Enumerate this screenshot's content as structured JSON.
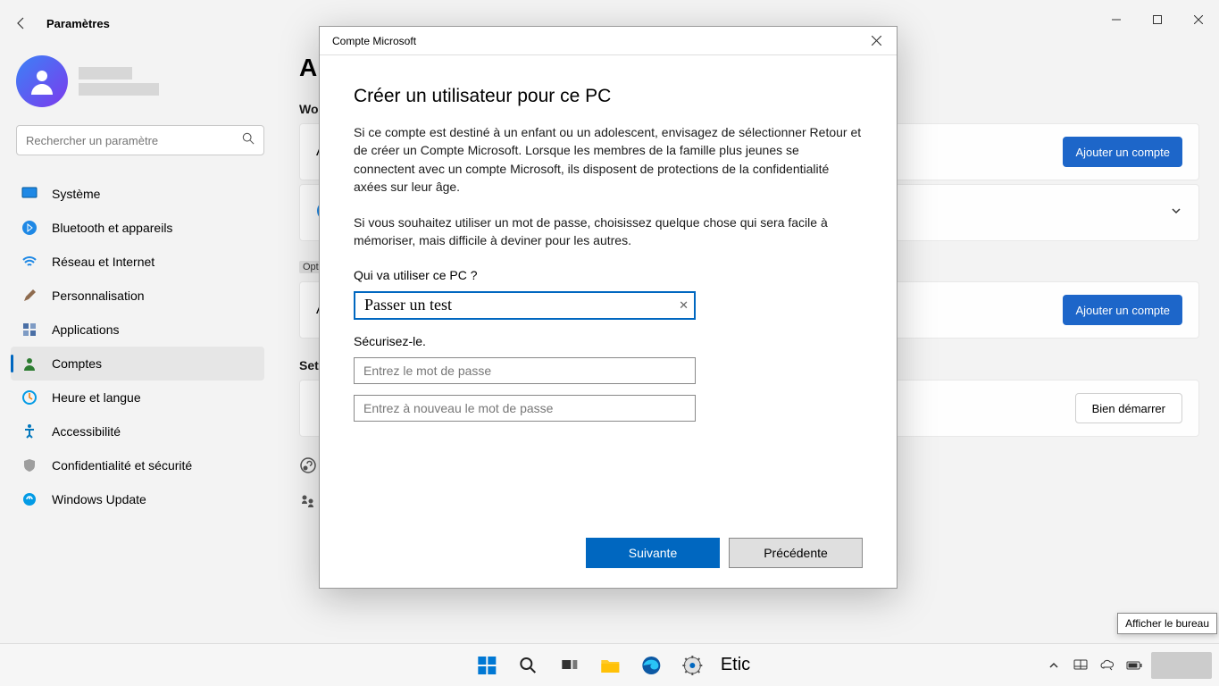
{
  "header": {
    "app_title": "Paramètres"
  },
  "search": {
    "placeholder": "Rechercher un paramètre"
  },
  "sidebar": {
    "items": [
      {
        "label": "Système"
      },
      {
        "label": "Bluetooth et appareils"
      },
      {
        "label": "Réseau et Internet"
      },
      {
        "label": "Personnalisation"
      },
      {
        "label": "Applications"
      },
      {
        "label": "Comptes"
      },
      {
        "label": "Heure et langue"
      },
      {
        "label": "Accessibilité"
      },
      {
        "label": "Confidentialité et sécurité"
      },
      {
        "label": "Windows Update"
      }
    ]
  },
  "main": {
    "title_visible": "A",
    "section_work": "Wo",
    "row_a_prefix": "A",
    "add_account": "Ajouter un compte",
    "options_tag": "Opt",
    "section_set": "Set",
    "bien_demarrer": "Bien démarrer"
  },
  "dialog": {
    "titlebar": "Compte Microsoft",
    "heading": "Créer un utilisateur pour ce PC",
    "para1": "Si ce compte est destiné à un enfant ou un adolescent, envisagez de sélectionner Retour et de créer un Compte Microsoft. Lorsque les membres de la famille plus jeunes se connectent avec un compte Microsoft, ils disposent de protections de la confidentialité axées sur leur âge.",
    "para2": "Si vous souhaitez utiliser un mot de passe, choisissez quelque chose qui sera facile à mémoriser, mais difficile à deviner pour les autres.",
    "who_label": "Qui va utiliser ce PC ?",
    "username_value": "Passer un test",
    "secure_label": "Sécurisez-le.",
    "pw1_placeholder": "Entrez le mot de passe",
    "pw2_placeholder": "Entrez à nouveau le mot de passe",
    "next": "Suivante",
    "prev": "Précédente"
  },
  "desktop": {
    "show_desktop_tip": "Afficher le bureau"
  },
  "taskbar": {
    "app_label": "Etic"
  }
}
